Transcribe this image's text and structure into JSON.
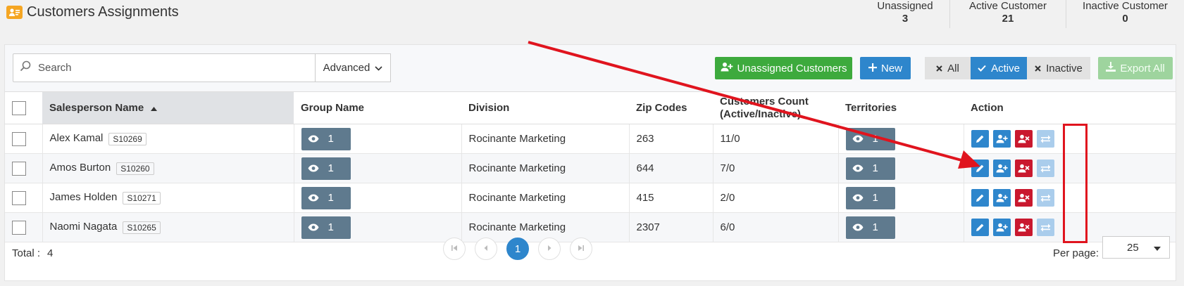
{
  "header": {
    "title": "Customers Assignments",
    "stats": [
      {
        "label": "Unassigned",
        "value": "3"
      },
      {
        "label": "Active Customer",
        "value": "21"
      },
      {
        "label": "Inactive Customer",
        "value": "0"
      }
    ]
  },
  "toolbar": {
    "search_placeholder": "Search",
    "advanced_label": "Advanced",
    "unassigned_label": "Unassigned Customers",
    "new_label": "New",
    "filter_all": "All",
    "filter_active": "Active",
    "filter_inactive": "Inactive",
    "export_label": "Export All"
  },
  "table": {
    "columns": {
      "salesperson": "Salesperson Name",
      "group": "Group Name",
      "division": "Division",
      "zip": "Zip Codes",
      "count_line1": "Customers Count",
      "count_line2": "(Active/Inactive)",
      "territories": "Territories",
      "action": "Action"
    },
    "rows": [
      {
        "name": "Alex Kamal",
        "code": "S10269",
        "group": "1",
        "division": "Rocinante Marketing",
        "zip": "263",
        "count": "11/0",
        "territories": "1"
      },
      {
        "name": "Amos Burton",
        "code": "S10260",
        "group": "1",
        "division": "Rocinante Marketing",
        "zip": "644",
        "count": "7/0",
        "territories": "1"
      },
      {
        "name": "James Holden",
        "code": "S10271",
        "group": "1",
        "division": "Rocinante Marketing",
        "zip": "415",
        "count": "2/0",
        "territories": "1"
      },
      {
        "name": "Naomi Nagata",
        "code": "S10265",
        "group": "1",
        "division": "Rocinante Marketing",
        "zip": "2307",
        "count": "6/0",
        "territories": "1"
      }
    ]
  },
  "footer": {
    "total_label": "Total :",
    "total_value": "4",
    "current_page": "1",
    "per_page_label": "Per page:",
    "per_page_value": "25"
  },
  "colors": {
    "accent": "#2e86cc",
    "success": "#3daa3d",
    "danger": "#c9182e",
    "annotation": "#e0141e"
  }
}
